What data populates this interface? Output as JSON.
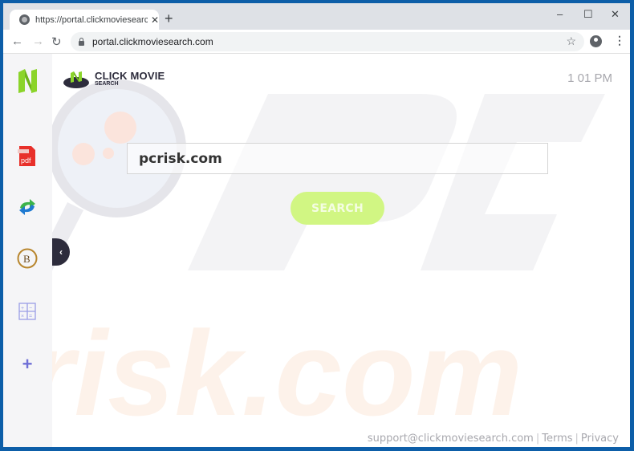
{
  "browser": {
    "tab_title": "https://portal.clickmoviesearch.com",
    "tab_icon": "globe-icon",
    "new_tab_label": "+",
    "address": "portal.clickmoviesearch.com",
    "controls": {
      "minimize": "–",
      "maximize": "☐",
      "close": "✕"
    },
    "nav": {
      "back": "←",
      "forward": "→",
      "reload": "↻"
    },
    "star": "☆",
    "menu": "⋮",
    "tab_close": "✕"
  },
  "sidebar": {
    "items": [
      {
        "name": "app-logo",
        "icon": "n-logo-icon"
      },
      {
        "name": "pdf",
        "icon": "pdf-icon",
        "label": "pdf"
      },
      {
        "name": "converter",
        "icon": "arrows-sync-icon"
      },
      {
        "name": "bitcoin",
        "icon": "bitcoin-icon",
        "label": "B"
      },
      {
        "name": "calculator",
        "icon": "calculator-icon"
      },
      {
        "name": "add",
        "icon": "plus-icon",
        "label": "+"
      }
    ],
    "collapse_label": "‹"
  },
  "header": {
    "logo_line1": "CLICK MOVIE",
    "logo_line2": "SEARCH",
    "time": "1 01 PM"
  },
  "search": {
    "value": "pcrisk.com",
    "button_label": "SEARCH"
  },
  "footer": {
    "email": "support@clickmoviesearch.com",
    "terms": "Terms",
    "privacy": "Privacy",
    "separator": "|"
  },
  "colors": {
    "accent_green": "#8bd42a",
    "button_green": "#d1f683",
    "dark": "#2d2c3c"
  }
}
